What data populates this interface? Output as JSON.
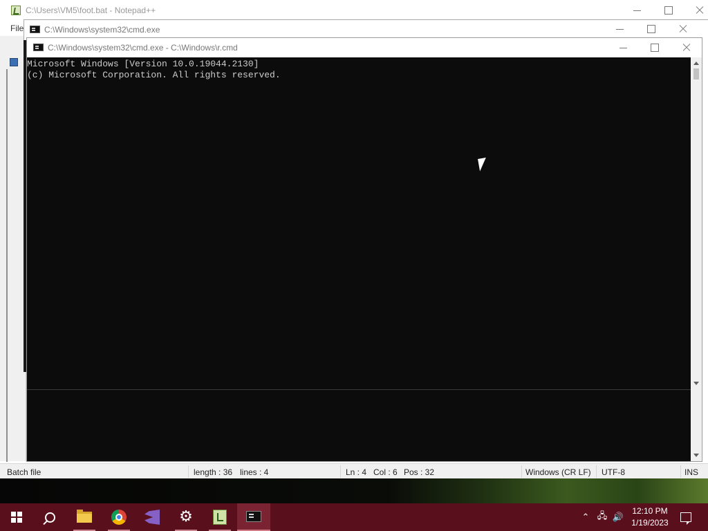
{
  "notepad": {
    "title": "C:\\Users\\VM5\\foot.bat - Notepad++",
    "menu_file": "File",
    "status": {
      "filetype": "Batch file",
      "length": "length : 36",
      "lines": "lines : 4",
      "ln": "Ln : 4",
      "col": "Col : 6",
      "pos": "Pos : 32",
      "eol": "Windows (CR LF)",
      "encoding": "UTF-8",
      "mode": "INS"
    },
    "icon": "notepadpp-icon"
  },
  "cmd_window_back": {
    "title": "C:\\Windows\\system32\\cmd.exe",
    "icon": "cmd-icon"
  },
  "cmd_window_front": {
    "title": "C:\\Windows\\system32\\cmd.exe - C:\\Windows\\r.cmd",
    "icon": "cmd-icon",
    "console_lines": [
      "Microsoft Windows [Version 10.0.19044.2130]",
      "(c) Microsoft Corporation. All rights reserved."
    ]
  },
  "taskbar": {
    "apps": [
      {
        "name": "start-button",
        "icon": "windows-logo-icon"
      },
      {
        "name": "search-button",
        "icon": "search-icon"
      },
      {
        "name": "file-explorer",
        "icon": "folder-icon"
      },
      {
        "name": "google-chrome",
        "icon": "chrome-icon"
      },
      {
        "name": "visual-studio",
        "icon": "visual-studio-icon"
      },
      {
        "name": "settings",
        "icon": "gear-icon"
      },
      {
        "name": "notepadpp",
        "icon": "notepadpp-icon"
      },
      {
        "name": "command-prompt",
        "icon": "cmd-icon"
      }
    ],
    "clock_time": "12:10 PM",
    "clock_date": "1/19/2023",
    "colors": {
      "taskbar_bg": "#5a0f1c",
      "active_bg": "#7a2433"
    }
  },
  "colors": {
    "console_bg": "#0c0c0c",
    "console_fg": "#cccccc"
  }
}
